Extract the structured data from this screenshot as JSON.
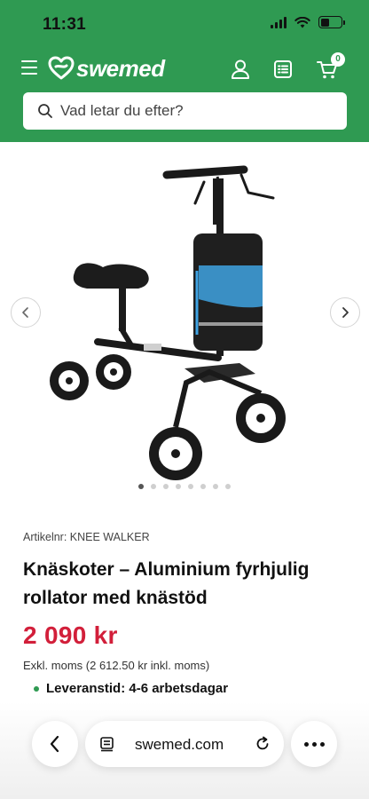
{
  "status": {
    "time": "11:31",
    "battery_level": 0.45
  },
  "header": {
    "logo_text": "swemed",
    "cart_count": "0"
  },
  "search": {
    "placeholder": "Vad letar du efter?"
  },
  "gallery": {
    "total_images": 8,
    "active_index": 0
  },
  "product": {
    "article": "Artikelnr: KNEE WALKER",
    "title": "Knäskoter – Aluminium fyrhjulig rollator med knästöd",
    "price": "2 090 kr",
    "price_note": "Exkl. moms (2 612.50 kr inkl. moms)",
    "delivery": "Leveranstid: 4-6 arbetsdagar"
  },
  "browser": {
    "url": "swemed.com"
  },
  "colors": {
    "brand_green": "#2f9a52",
    "price_red": "#d21f3a"
  }
}
